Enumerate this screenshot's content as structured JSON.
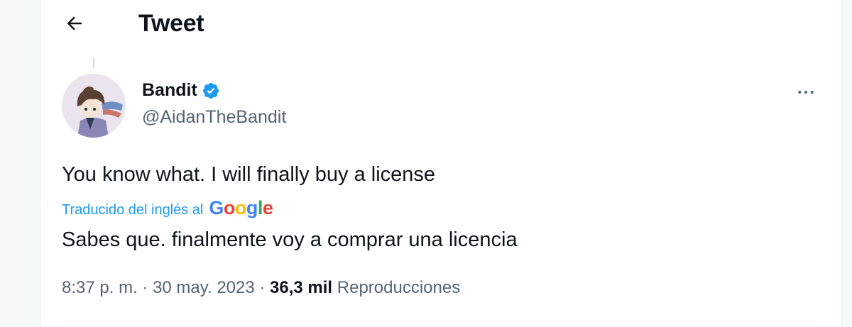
{
  "header": {
    "back_icon": "arrow-left-icon",
    "title": "Tweet"
  },
  "tweet": {
    "author": {
      "display_name": "Bandit",
      "handle": "@AidanTheBandit",
      "verified": true,
      "verified_icon": "verified-badge-icon",
      "verified_color": "#1d9bf0"
    },
    "more_icon": "more-horizontal-icon",
    "text": "You know what. I will finally buy a license",
    "translation": {
      "label": "Traducido del inglés al",
      "provider": "Google",
      "text": "Sabes que. finalmente voy a comprar una licencia"
    },
    "meta": {
      "time": "8:37 p. m.",
      "separator": " · ",
      "date": "30 may. 2023",
      "views_count": "36,3 mil",
      "views_label": "Reproducciones"
    }
  },
  "colors": {
    "accent": "#1d9bf0",
    "text_primary": "#0f1419",
    "text_secondary": "#536471"
  }
}
